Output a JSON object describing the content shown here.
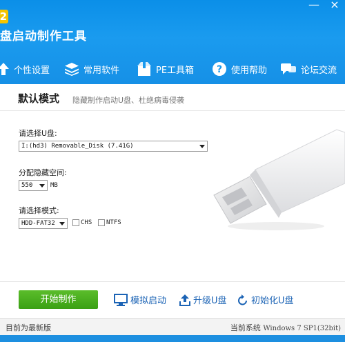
{
  "app": {
    "badge": "2",
    "title": "盘启动制作工具",
    "window_controls": {
      "minimize": "—",
      "close": "×"
    }
  },
  "nav": [
    {
      "label": "个性设置",
      "icon": "arrow-up-icon"
    },
    {
      "label": "常用软件",
      "icon": "stack-icon"
    },
    {
      "label": "PE工具箱",
      "icon": "box-icon"
    },
    {
      "label": "使用帮助",
      "icon": "help-icon"
    },
    {
      "label": "论坛交流",
      "icon": "chat-icon"
    }
  ],
  "mode": {
    "title": "默认模式",
    "subtitle": "隐藏制作启动U盘、杜绝病毒侵袭"
  },
  "form": {
    "select_disk_label": "请选择U盘:",
    "disk_value": "I:(hd3) Removable_Disk (7.41G)",
    "hidden_space_label": "分配隐藏空间:",
    "space_value": "550",
    "space_unit": "MB",
    "select_mode_label": "请选择模式:",
    "mode_value": "HDD-FAT32",
    "chs_label": "CHS",
    "ntfs_label": "NTFS"
  },
  "actions": {
    "start": "开始制作",
    "simulate": "模拟启动",
    "upgrade": "升级U盘",
    "init": "初始化U盘"
  },
  "status": {
    "left": "目前为最新版",
    "right_prefix": "当前系统",
    "right_value": "Windows 7 SP1(32bit)"
  },
  "colors": {
    "header": "#1a9bef",
    "start_button": "#4caf20",
    "link": "#1b63b5"
  }
}
